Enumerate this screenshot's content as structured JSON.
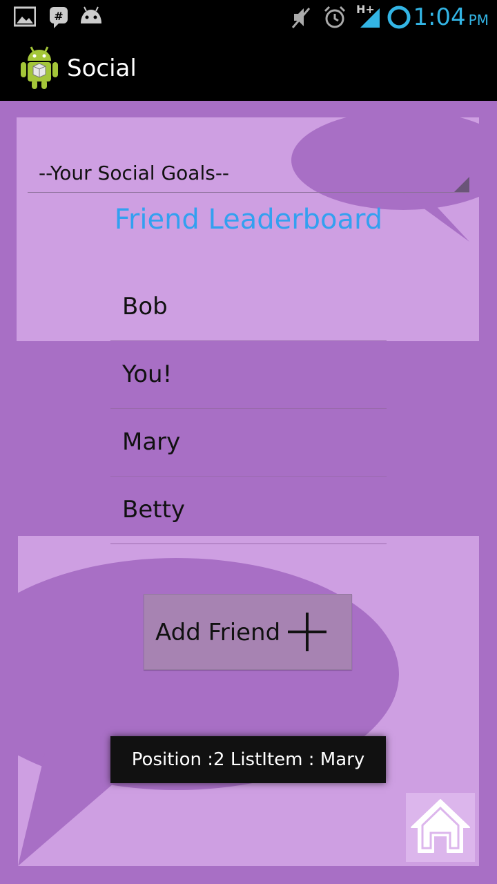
{
  "status_bar": {
    "time": "1:04",
    "ampm": "PM",
    "network": "H+",
    "icons": [
      "gallery-icon",
      "talk-icon",
      "android-notification-icon",
      "mute-icon",
      "alarm-icon",
      "signal-icon",
      "sync-icon"
    ]
  },
  "app": {
    "title": "Social",
    "icon": "android-app-icon"
  },
  "goals_spinner": {
    "selected": "--Your Social Goals--"
  },
  "leaderboard": {
    "title": "Friend Leaderboard",
    "items": [
      "Bob",
      "You!",
      "Mary",
      "Betty"
    ]
  },
  "add_friend_button": {
    "label": "Add Friend",
    "icon": "plus-icon"
  },
  "toast": {
    "text": "Position :2  ListItem : Mary"
  },
  "home_button": {
    "icon": "home-icon"
  },
  "colors": {
    "background": "#a86fc5",
    "panel": "#ce9fe2",
    "title_blue": "#33a0f0",
    "status_blue": "#33b5e5"
  }
}
